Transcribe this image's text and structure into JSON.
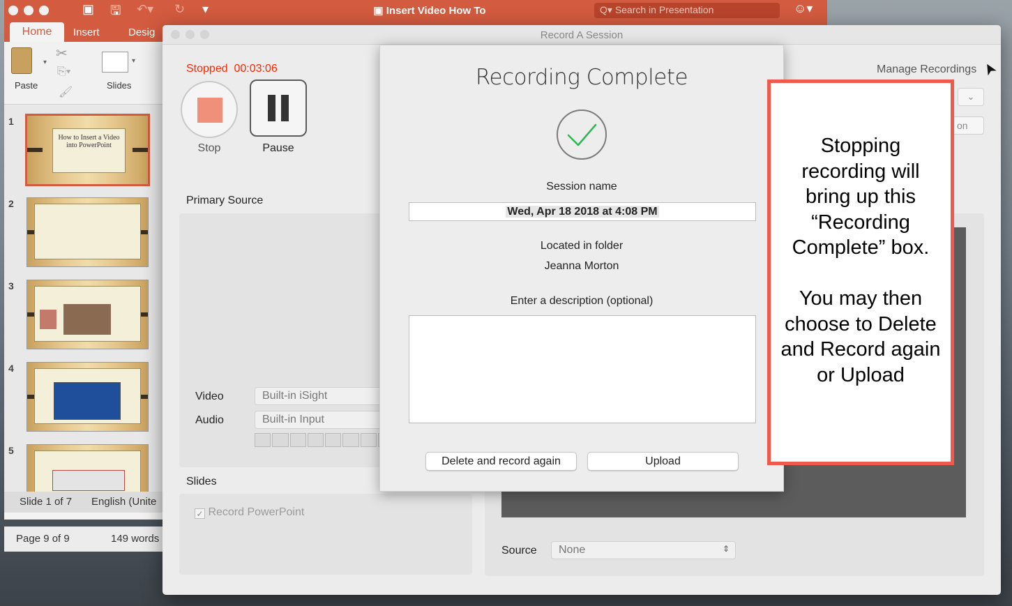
{
  "powerpoint": {
    "title": "Insert Video How To",
    "search_placeholder": "Search in Presentation",
    "tabs": [
      "Home",
      "Insert",
      "Desig"
    ],
    "ribbon": {
      "paste_label": "Paste",
      "slides_label": "Slides"
    },
    "slide_numbers": [
      "1",
      "2",
      "3",
      "4",
      "5"
    ],
    "slide1_title": "How to Insert a Video into PowerPoint",
    "status": {
      "slide": "Slide 1 of 7",
      "language": "English (Unite"
    },
    "colors": {
      "accent": "#d35b3f"
    }
  },
  "word_status": {
    "page": "Page 9 of 9",
    "words": "149 words"
  },
  "record_window": {
    "title": "Record A Session",
    "status": "Stopped",
    "timer": "00:03:06",
    "stop_label": "Stop",
    "pause_label": "Pause",
    "primary_source": "Primary Source",
    "video_label": "Video",
    "video_value": "Built-in iSight",
    "audio_label": "Audio",
    "audio_value": "Built-in Input",
    "slides_title": "Slides",
    "record_ppt_label": "Record PowerPoint",
    "record_ppt_checked": true,
    "manage_recordings": "Manage Recordings",
    "right_button_fragment": "on",
    "source_label": "Source",
    "source_value": "None",
    "colors": {
      "stopped": "#ff2600",
      "stop_square": "#f0907a"
    }
  },
  "sheet": {
    "title": "Recording Complete",
    "session_name_label": "Session name",
    "session_name_value": "Wed, Apr 18 2018 at 4:08 PM",
    "folder_label": "Located in folder",
    "folder_value": "Jeanna Morton",
    "description_label": "Enter a description (optional)",
    "description_value": "",
    "delete_button": "Delete and record again",
    "upload_button": "Upload",
    "colors": {
      "check": "#2fb552"
    }
  },
  "callout": {
    "text": "Stopping recording will bring up this “Recording Complete” box.\n\nYou may then choose to Delete and Record again or Upload",
    "colors": {
      "border": "#f05a4e"
    }
  }
}
